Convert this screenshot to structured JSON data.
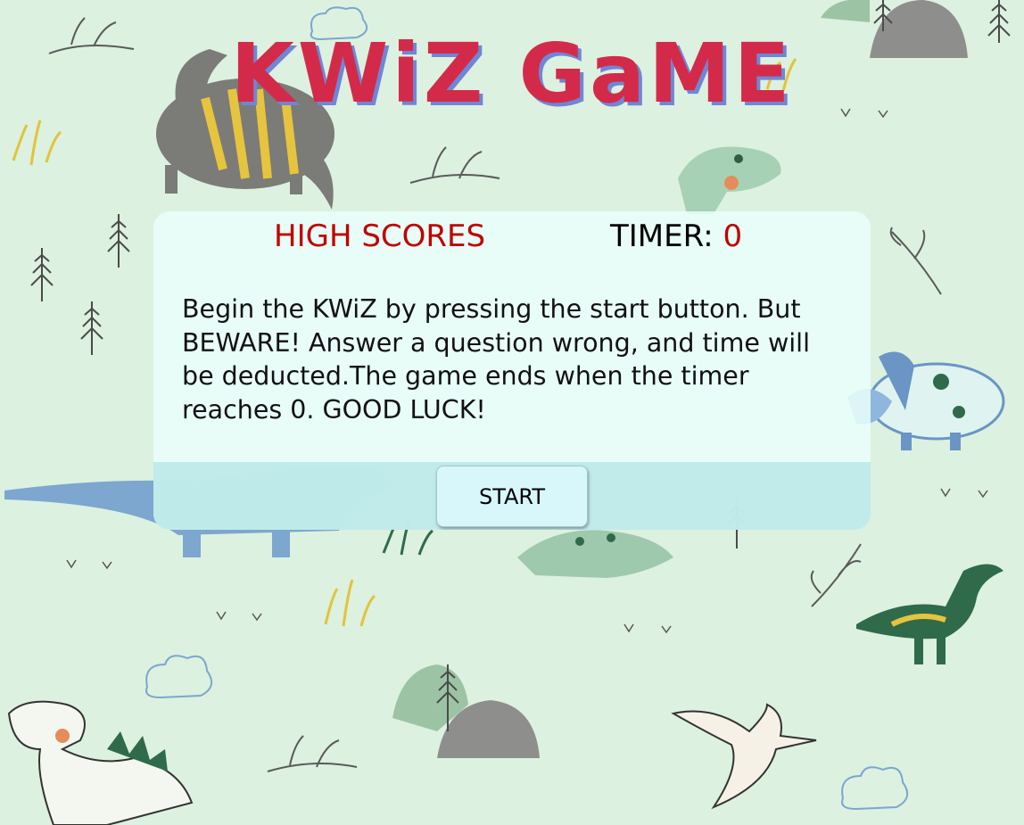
{
  "game": {
    "title": "KWiZ GaME",
    "high_scores_label": "HIGH SCORES",
    "timer_label": "TIMER: ",
    "timer_value": "0",
    "instructions": "Begin the KWiZ by pressing the start button. But BEWARE! Answer a question wrong, and time will be deducted.The game ends when the timer reaches 0. GOOD LUCK!",
    "start_label": "START"
  },
  "colors": {
    "background": "#dcf1df",
    "title": "#d42a4a",
    "title_shadow": "#6f86d6",
    "accent_red": "#c00000",
    "card": "#eafffa",
    "footer": "#bae8e8",
    "button": "#d8f7fb"
  },
  "decorations": [
    "stegosaurus",
    "trex",
    "triceratops",
    "brachiosaurus",
    "pterodactyl",
    "parasaurolophus",
    "ankylosaurus",
    "leaf",
    "fern",
    "pine-tree",
    "grass-tuft",
    "cloud",
    "rock"
  ]
}
